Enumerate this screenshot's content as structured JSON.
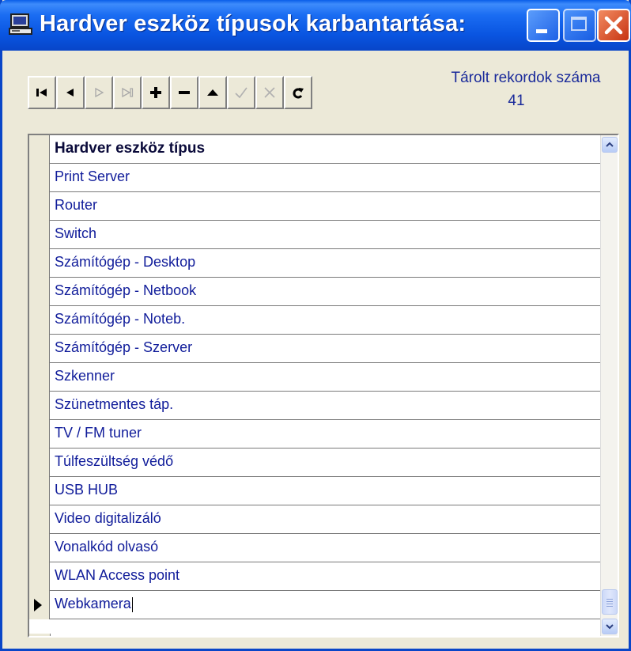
{
  "window": {
    "title": "Hardver eszköz típusok karbantartása:",
    "colors": {
      "titlebar": "#0a5ee8",
      "close": "#d9481c",
      "text": "#101c9a"
    }
  },
  "toolbar": {
    "buttons": [
      {
        "name": "first-record-button",
        "icon": "first-icon",
        "enabled": true
      },
      {
        "name": "prior-record-button",
        "icon": "prior-icon",
        "enabled": true
      },
      {
        "name": "next-record-button",
        "icon": "next-icon",
        "enabled": false
      },
      {
        "name": "last-record-button",
        "icon": "last-icon",
        "enabled": false
      },
      {
        "name": "insert-record-button",
        "icon": "plus-icon",
        "enabled": true
      },
      {
        "name": "delete-record-button",
        "icon": "minus-icon",
        "enabled": true
      },
      {
        "name": "edit-record-button",
        "icon": "up-triangle-icon",
        "enabled": true
      },
      {
        "name": "post-edit-button",
        "icon": "checkmark-icon",
        "enabled": false
      },
      {
        "name": "cancel-edit-button",
        "icon": "x-icon",
        "enabled": false
      },
      {
        "name": "refresh-data-button",
        "icon": "refresh-icon",
        "enabled": true
      }
    ],
    "records_label": "Tárolt rekordok száma",
    "records_count": "41"
  },
  "grid": {
    "column_header": "Hardver eszköz típus",
    "rows": [
      "Print Server",
      "Router",
      "Switch",
      "Számítógép - Desktop",
      "Számítógép - Netbook",
      "Számítógép - Noteb.",
      "Számítógép - Szerver",
      "Szkenner",
      "Szünetmentes táp.",
      "TV / FM tuner",
      "Túlfeszültség védő",
      "USB HUB",
      "Video digitalizáló",
      "Vonalkód olvasó",
      "WLAN Access point",
      "Webkamera"
    ],
    "current_row_index": 15
  }
}
